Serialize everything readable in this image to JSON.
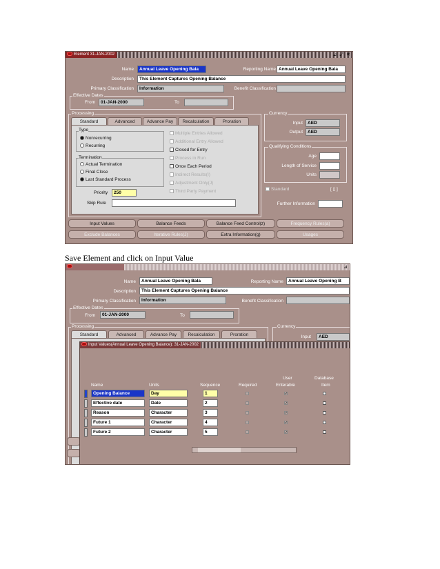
{
  "top_window": {
    "title": "Element 31-JAN-2002",
    "controls": "⊿ ⤢ ✕",
    "labels": {
      "name": "Name",
      "description": "Description",
      "primary_classification": "Primary Classification",
      "reporting_name": "Reporting Name",
      "benefit_classification": "Benefit Classification",
      "effective_dates": "Effective Dates",
      "from": "From",
      "to": "To",
      "processing": "Processing",
      "currency": "Currency",
      "input": "Input",
      "output": "Output",
      "qualifying_conditions": "Qualifying Conditions",
      "age": "Age",
      "length_of_service": "Length of Service",
      "units": "Units",
      "standard": "Standard",
      "further_information": "Further Information",
      "type": "Type",
      "termination": "Termination",
      "priority": "Priority",
      "skip_rule": "Skip Rule",
      "bracket": "[ ▯ ]"
    },
    "values": {
      "name": "Annual Leave Opening Bala",
      "description": "This Element Captures Opening Balance",
      "primary_classification": "Information",
      "reporting_name": "Annual Leave Opening Bala",
      "from": "01-JAN-2000",
      "input_currency": "AED",
      "output_currency": "AED",
      "priority": "250"
    },
    "tabs": [
      "Standard",
      "Advanced",
      "Advance Pay",
      "Recalculation",
      "Proration"
    ],
    "type_options": [
      "Nonrecurring",
      "Recurring"
    ],
    "termination_options": [
      "Actual Termination",
      "Final Close",
      "Last Standard Process"
    ],
    "checkboxes": [
      "Multiple Entries Allowed",
      "Additional Entry Allowed",
      "Closed for Entry",
      "Process in Run",
      "Once Each Period",
      "Indirect Results(I)",
      "Adjustment Only(J)",
      "Third Party Payment"
    ],
    "buttons_row1": [
      "Input Values",
      "Balance Feeds",
      "Balance Feed Control(z)",
      "Frequency Rules(a)"
    ],
    "buttons_row2": [
      "Exclude Balances",
      "Iterative Rules(J)",
      "Extra Information(g)",
      "Usages"
    ]
  },
  "caption": "Save Element  and  click  on Input Value",
  "bottom_window": {
    "controls": "⊿",
    "labels": {
      "name": "Name",
      "description": "Description",
      "primary_classification": "Primary Classification",
      "reporting_name": "Reporting Name",
      "benefit_classification": "Benefit Classification",
      "effective_dates": "Effective Dates",
      "from": "From",
      "to": "To",
      "processing": "Processing",
      "currency": "Currency",
      "input": "Input"
    },
    "values": {
      "name": "Annual Leave Opening Bala",
      "description": "This Element Captures Opening Balance",
      "primary_classification": "Information",
      "reporting_name": "Annual Leave Opening B",
      "from": "01-JAN-2000",
      "input_currency": "AED"
    },
    "tabs": [
      "Standard",
      "Advanced",
      "Advance Pay",
      "Recalculation",
      "Proration"
    ]
  },
  "input_values_window": {
    "title": "Input Values(Annual Leave Opening Balance): 31-JAN-2002",
    "headers": {
      "name": "Name",
      "units": "Units",
      "sequence": "Sequence",
      "required": "Required",
      "user_enterable_1": "User",
      "user_enterable_2": "Enterable",
      "database_item_1": "Database",
      "database_item_2": "Item"
    },
    "rows": [
      {
        "name": "Opening Balance",
        "units": "Day",
        "sequence": "1",
        "required": false,
        "user_enterable": true,
        "database_item": false
      },
      {
        "name": "Effective date",
        "units": "Date",
        "sequence": "2",
        "required": false,
        "user_enterable": true,
        "database_item": false
      },
      {
        "name": "Reason",
        "units": "Character",
        "sequence": "3",
        "required": false,
        "user_enterable": true,
        "database_item": false
      },
      {
        "name": "Future 1",
        "units": "Character",
        "sequence": "4",
        "required": false,
        "user_enterable": true,
        "database_item": false
      },
      {
        "name": "Future 2",
        "units": "Character",
        "sequence": "5",
        "required": false,
        "user_enterable": true,
        "database_item": false
      }
    ]
  }
}
